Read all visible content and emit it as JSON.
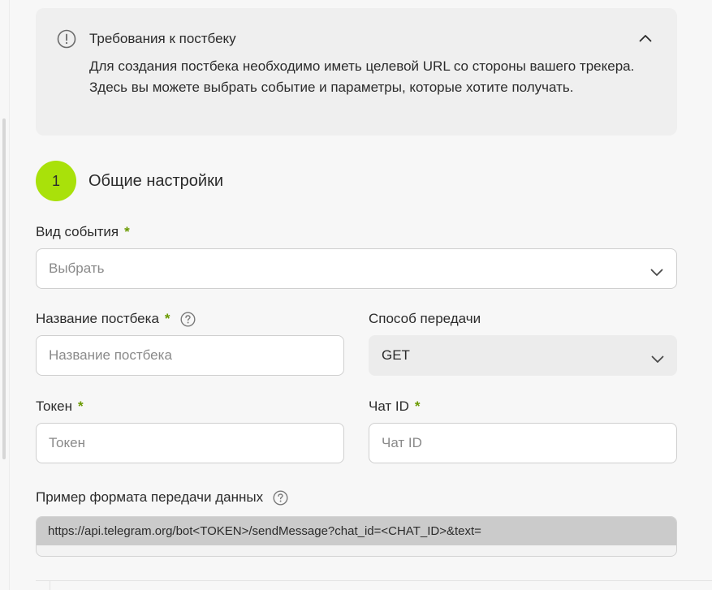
{
  "info": {
    "title": "Требования к постбеку",
    "text": "Для создания постбека необходимо иметь целевой URL со стороны вашего трекера. Здесь вы можете выбрать событие и параметры, которые хотите получать."
  },
  "step": {
    "number": "1",
    "title": "Общие настройки"
  },
  "event_type": {
    "label": "Вид события",
    "required_mark": "*",
    "placeholder": "Выбрать"
  },
  "postback_name": {
    "label": "Название постбека",
    "required_mark": "*",
    "placeholder": "Название постбека"
  },
  "transfer_method": {
    "label": "Способ передачи",
    "value": "GET"
  },
  "token": {
    "label": "Токен",
    "required_mark": "*",
    "placeholder": "Токен"
  },
  "chat_id": {
    "label": "Чат ID",
    "required_mark": "*",
    "placeholder": "Чат ID"
  },
  "example": {
    "label": "Пример формата передачи данных",
    "value": "https://api.telegram.org/bot<TOKEN>/sendMessage?chat_id=<CHAT_ID>&text="
  },
  "colors": {
    "accent": "#a9e10a",
    "required": "#6a9a00",
    "info_bg": "#efefef"
  },
  "icons": {
    "info": "exclamation-circle-icon",
    "collapse": "chevron-up-icon",
    "dropdown": "chevron-down-icon",
    "help": "question-circle-icon"
  }
}
